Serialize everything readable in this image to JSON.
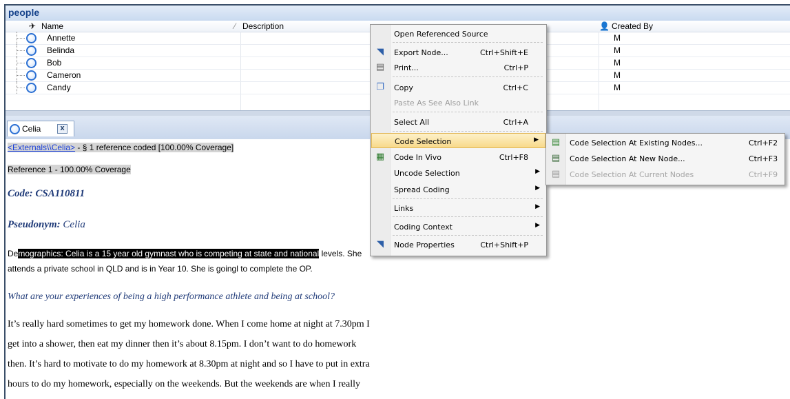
{
  "panel": {
    "title": "people",
    "columns": {
      "name": "Name",
      "description": "Description",
      "created_by": "Created By"
    },
    "rows": [
      {
        "name": "Annette",
        "created_by": "M"
      },
      {
        "name": "Belinda",
        "created_by": "M"
      },
      {
        "name": "Bob",
        "created_by": "M"
      },
      {
        "name": "Cameron",
        "created_by": "M"
      },
      {
        "name": "Candy",
        "created_by": "M"
      }
    ]
  },
  "tab": {
    "label": "Celia",
    "close": "x"
  },
  "document": {
    "ref_link": "<Externals\\\\Celia>",
    "ref_summary": " - § 1 reference coded  [100.00% Coverage]",
    "reference": "Reference 1 - 100.00% Coverage",
    "code_label": "Code:",
    "code_value": " CSA110811",
    "pseudonym_label": "Pseudonym:",
    "pseudonym_value": " Celia",
    "demo_prefix": "De",
    "demo_selected": "mographics: Celia is a 15 year old gymnast who is competing at state and national",
    "demo_rest": " levels. She",
    "demo_line2": "attends a private school in QLD and is in Year 10. She is goingl to complete the OP.",
    "question": "What are your experiences of being a high performance athlete and being at school?",
    "para": [
      "It’s really hard sometimes to get my homework done. When I come home at night at 7.30pm I",
      "get into a shower, then eat my dinner then it’s about 8.15pm. I don’t want to do homework",
      "then. It’s hard to motivate to do my homework at 8.30pm at night and so I have to put in extra",
      "hours to do my homework, especially on the weekends. But the weekends are when I really"
    ]
  },
  "context_menu": {
    "open_ref": "Open Referenced Source",
    "export": "Export Node...",
    "export_key": "Ctrl+Shift+E",
    "print": "Print...",
    "print_key": "Ctrl+P",
    "copy": "Copy",
    "copy_key": "Ctrl+C",
    "paste": "Paste As See Also Link",
    "select_all": "Select All",
    "select_all_key": "Ctrl+A",
    "code_selection": "Code Selection",
    "code_in_vivo": "Code In Vivo",
    "code_in_vivo_key": "Ctrl+F8",
    "uncode": "Uncode Selection",
    "spread": "Spread Coding",
    "links": "Links",
    "coding_context": "Coding Context",
    "node_props": "Node Properties",
    "node_props_key": "Ctrl+Shift+P"
  },
  "submenu": {
    "existing": "Code Selection At Existing Nodes...",
    "existing_key": "Ctrl+F2",
    "new_node": "Code Selection At New Node...",
    "new_node_key": "Ctrl+F3",
    "current": "Code Selection At Current Nodes",
    "current_key": "Ctrl+F9"
  },
  "colors": {
    "accent": "#15428b",
    "highlight": "#f8d98a",
    "link": "#1a3fd8"
  },
  "icons": {
    "node": "node-circle-icon",
    "export": "export-icon",
    "print": "printer-icon",
    "copy": "copy-icon",
    "code_in_vivo": "code-in-vivo-icon",
    "node_props": "node-properties-icon",
    "existing": "code-existing-icon",
    "new_node": "code-new-icon",
    "current": "code-current-icon"
  }
}
